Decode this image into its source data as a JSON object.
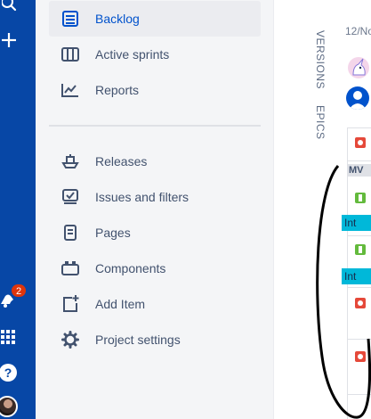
{
  "global_nav": {
    "icons": [
      "search-icon",
      "create-icon",
      "notifications-icon",
      "app-switcher-icon",
      "help-icon",
      "profile-avatar"
    ],
    "notification_count": "2",
    "help_glyph": "?",
    "colors": {
      "rail": "#0747a6",
      "badge": "#de350b"
    }
  },
  "sidebar": {
    "items": [
      {
        "label": "Backlog",
        "icon": "backlog-icon",
        "selected": true
      },
      {
        "label": "Active sprints",
        "icon": "board-icon"
      },
      {
        "label": "Reports",
        "icon": "reports-icon"
      },
      {
        "label": "Releases",
        "icon": "ship-icon"
      },
      {
        "label": "Issues and filters",
        "icon": "issues-filters-icon"
      },
      {
        "label": "Pages",
        "icon": "page-icon"
      },
      {
        "label": "Components",
        "icon": "components-icon"
      },
      {
        "label": "Add Item",
        "icon": "add-item-icon"
      },
      {
        "label": "Project settings",
        "icon": "gear-icon"
      }
    ],
    "colors": {
      "background": "#f4f5f7",
      "selected_text": "#0052cc"
    }
  },
  "main": {
    "tabs": {
      "versions": "VERSIONS",
      "epics": "EPICS"
    },
    "date": "12/No",
    "rows": [
      {
        "type": "bug"
      },
      {
        "version": "MV"
      },
      {
        "type": "story",
        "epic": "Int"
      },
      {
        "type": "story",
        "epic": "Int"
      },
      {
        "type": "bug"
      },
      {
        "type": "bug"
      }
    ],
    "colors": {
      "epic_chip": "#00b8d9",
      "bug": "#e5493a",
      "story": "#63ba3c"
    }
  }
}
